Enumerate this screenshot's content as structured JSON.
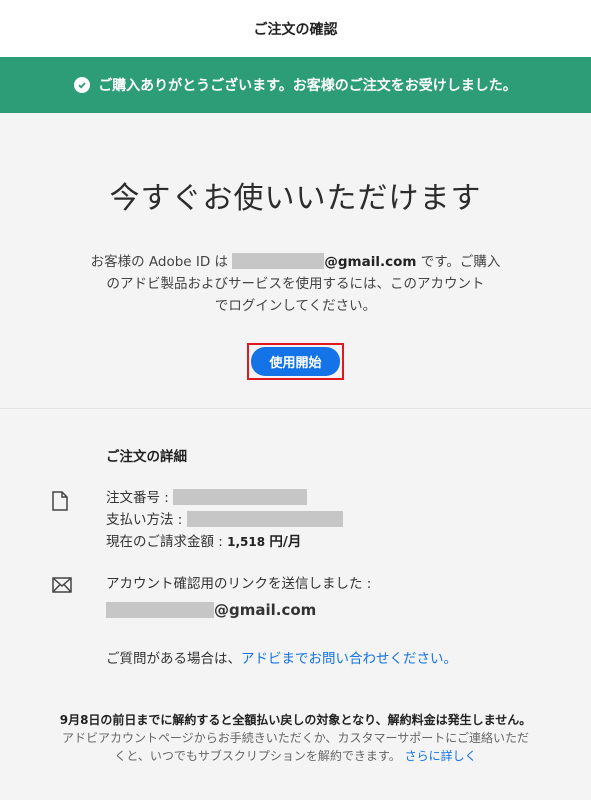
{
  "header": {
    "title": "ご注文の確認"
  },
  "banner": {
    "message": "ご購入ありがとうございます。お客様のご注文をお受けしました。"
  },
  "hero": {
    "heading": "今すぐお使いいただけます",
    "desc_prefix": "お客様の Adobe ID は",
    "desc_email_suffix": "@gmail.com",
    "desc_rest_1": " です。ご購入",
    "desc_line2": "のアドビ製品およびサービスを使用するには、このアカウント",
    "desc_line3": "でログインしてください。",
    "button_label": "使用開始"
  },
  "details": {
    "title": "ご注文の詳細",
    "order_number_label": "注文番号 :",
    "payment_label": "支払い方法 :",
    "billing_label": "現在のご請求金額 :",
    "billing_amount": "1,518",
    "billing_unit": "円/月",
    "email_sent_label": "アカウント確認用のリンクを送信しました :",
    "email_suffix": "@gmail.com",
    "question_prefix": "ご質問がある場合は、",
    "question_link": "アドビまでお問い合わせください。"
  },
  "footer": {
    "line1": "9月8日の前日までに解約すると全額払い戻しの対象となり、解約料金は発生しません。",
    "line2": "アドビアカウントページからお手続きいただくか、カスタマーサポートにご連絡いただ",
    "line3": "くと、いつでもサブスクリプションを解約できます。",
    "more_link": "さらに詳しく"
  }
}
